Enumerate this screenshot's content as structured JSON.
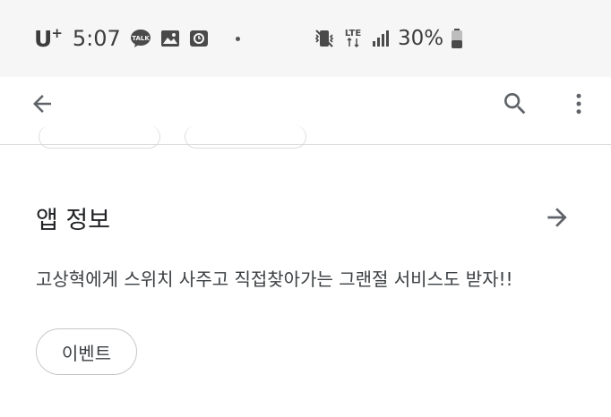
{
  "status_bar": {
    "carrier": "U",
    "carrier_sup": "+",
    "time": "5:07",
    "battery_percent": "30%",
    "network": "LTE",
    "notification_icons": [
      "talk-icon",
      "image-icon",
      "screen-record-icon"
    ],
    "system_icons": [
      "vibrate-icon",
      "lte-icon",
      "signal-icon",
      "battery-icon"
    ]
  },
  "app_bar": {
    "icons": [
      "back-arrow-icon",
      "search-icon",
      "more-vert-icon"
    ]
  },
  "section": {
    "title": "앱 정보",
    "description": "고상혁에게 스위치 사주고 직접찾아가는 그랜절 서비스도 받자!!",
    "chip_label": "이벤트"
  },
  "colors": {
    "status_bar_bg": "#f6f6f6",
    "background": "#ffffff",
    "text": "#202124",
    "icon": "#5f6368"
  }
}
